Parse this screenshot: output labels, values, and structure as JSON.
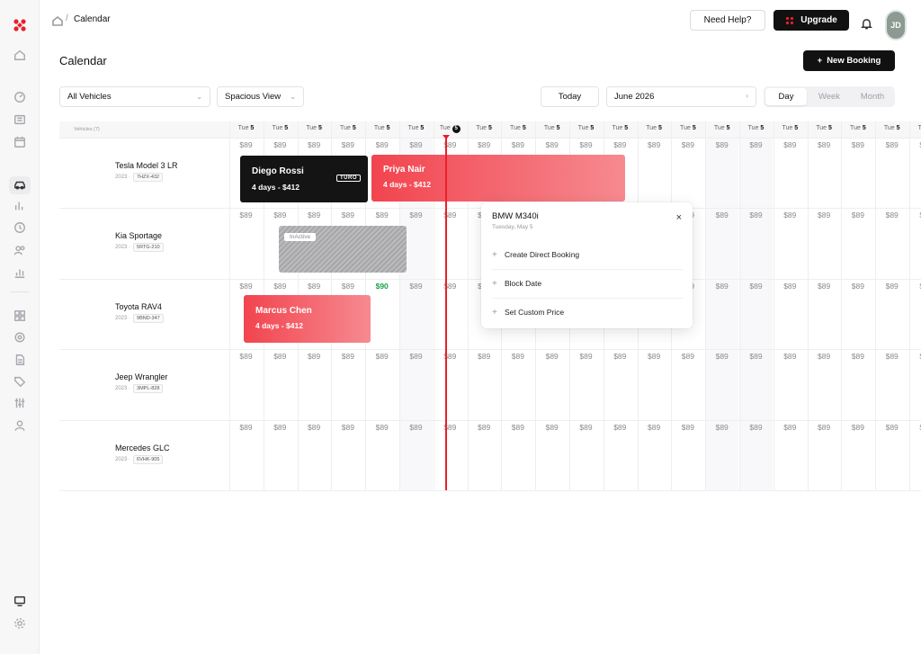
{
  "topbar": {
    "breadcrumb": "Calendar",
    "help_label": "Need Help?",
    "upgrade_label": "Upgrade",
    "avatar_initials": "JD"
  },
  "page": {
    "title": "Calendar",
    "new_booking_label": "New Booking"
  },
  "filters": {
    "vehicles": "All Vehicles",
    "view": "Spacious View",
    "today_label": "Today",
    "month": "June 2026",
    "view_modes": [
      "Day",
      "Week",
      "Month"
    ],
    "active_view_mode": "Day"
  },
  "grid": {
    "vehicles_header": "Vehicles (7)",
    "columns": [
      {
        "dow": "Tue",
        "day": "5"
      },
      {
        "dow": "Tue",
        "day": "5"
      },
      {
        "dow": "Tue",
        "day": "5"
      },
      {
        "dow": "Tue",
        "day": "5"
      },
      {
        "dow": "Tue",
        "day": "5"
      },
      {
        "dow": "Tue",
        "day": "5"
      },
      {
        "dow": "Tue",
        "day": "5",
        "today": true
      },
      {
        "dow": "Tue",
        "day": "5"
      },
      {
        "dow": "Tue",
        "day": "5"
      },
      {
        "dow": "Tue",
        "day": "5"
      },
      {
        "dow": "Tue",
        "day": "5"
      },
      {
        "dow": "Tue",
        "day": "5"
      },
      {
        "dow": "Tue",
        "day": "5"
      },
      {
        "dow": "Tue",
        "day": "5"
      },
      {
        "dow": "Tue",
        "day": "5"
      },
      {
        "dow": "Tue",
        "day": "5"
      },
      {
        "dow": "Tue",
        "day": "5"
      },
      {
        "dow": "Tue",
        "day": "5"
      },
      {
        "dow": "Tue",
        "day": "5"
      },
      {
        "dow": "Tue",
        "day": "5"
      },
      {
        "dow": "Tue",
        "day": "5"
      }
    ],
    "default_price": "$89",
    "vehicles": [
      {
        "name": "Tesla Model 3 LR",
        "year": "2023 ·",
        "plate": "7HZX-432"
      },
      {
        "name": "Kia Sportage",
        "year": "2023 ·",
        "plate": "5RTG-210"
      },
      {
        "name": "Toyota RAV4",
        "year": "2023 ·",
        "plate": "9BND-347"
      },
      {
        "name": "Jeep Wrangler",
        "year": "2023 ·",
        "plate": "3MPL-828"
      },
      {
        "name": "Mercedes GLC",
        "year": "2023 ·",
        "plate": "6VHK-905"
      }
    ],
    "special_price": {
      "row": 2,
      "col": 4,
      "value": "$90"
    }
  },
  "bookings": [
    {
      "name": "Diego Rossi",
      "meta": "4 days - $412",
      "source": "TURO"
    },
    {
      "name": "Priya Nair",
      "meta": "4 days - $412"
    },
    {
      "name": "Marcus Chen",
      "meta": "4 days - $412"
    }
  ],
  "inactive_label": "InActive",
  "popup": {
    "title": "BMW M340i",
    "subtitle": "Tuesday, May 5",
    "close": "×",
    "items": [
      "Create Direct Booking",
      "Block Date",
      "Set Custom Price"
    ]
  },
  "colors": {
    "brand_red": "#e8202a",
    "booking_dark": "#141414",
    "price_highlight": "#1a9e4a"
  }
}
